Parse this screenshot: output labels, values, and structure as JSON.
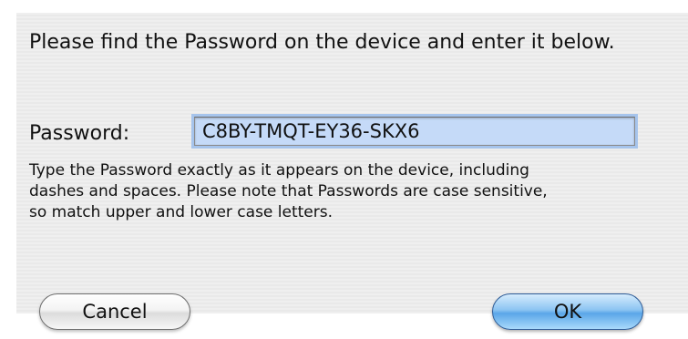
{
  "dialog": {
    "prompt": "Please find the Password on the device and enter it below.",
    "password_label": "Password:",
    "password_value": "C8BY-TMQT-EY36-SKX6",
    "help_lines": [
      "Type the Password exactly as it appears on the device,  including",
      "dashes and spaces.  Please note that Passwords are case sensitive,",
      "so match upper and lower case letters."
    ],
    "cancel_label": "Cancel",
    "ok_label": "OK"
  },
  "colors": {
    "field_highlight": "#c5daf8",
    "default_button": "#5aa6e8"
  }
}
